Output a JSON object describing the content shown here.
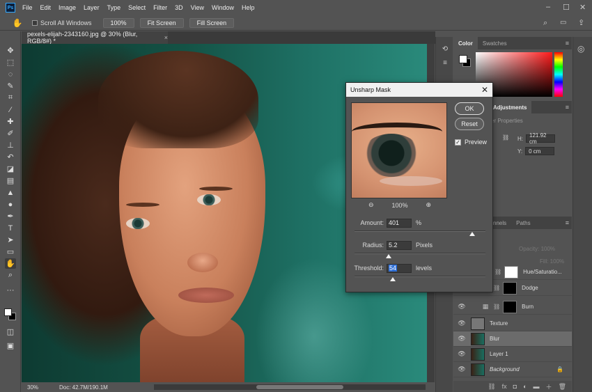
{
  "menubar": {
    "logo": "Ps",
    "items": [
      "File",
      "Edit",
      "Image",
      "Layer",
      "Type",
      "Select",
      "Filter",
      "3D",
      "View",
      "Window",
      "Help"
    ]
  },
  "options": {
    "scroll_all": "Scroll All Windows",
    "zoom_btn": "100%",
    "fit_btn": "Fit Screen",
    "fill_btn": "Fill Screen"
  },
  "document": {
    "tab_title": "pexels-elijah-2343160.jpg @ 30% (Blur, RGB/8#) *",
    "close": "×"
  },
  "status": {
    "zoom": "30%",
    "doc_size": "Doc: 42.7M/190.1M"
  },
  "color_panel": {
    "tabs": [
      "Color",
      "Swatches"
    ],
    "fg": "#ffffff",
    "bg": "#000000",
    "hue": "#ff1a1a"
  },
  "properties_panel": {
    "tab_fragment": "Adjustments",
    "title_fragment": "yer Properties",
    "h_label": "H:",
    "h_value": "121.92 cm",
    "y_label": "Y:",
    "y_value": "0 cm"
  },
  "layers_panel": {
    "tabs": [
      "nnels",
      "Paths"
    ],
    "opacity_label": "Opacity: 100%",
    "fill_label": "Fill: 100%",
    "layers": [
      {
        "name": "Hue/Saturatio...",
        "kind": "adjustment"
      },
      {
        "name": "Dodge",
        "kind": "adjustment"
      },
      {
        "name": "Burn",
        "kind": "adjustment"
      },
      {
        "name": "Texture",
        "kind": "gray"
      },
      {
        "name": "Blur",
        "kind": "photo",
        "selected": true
      },
      {
        "name": "Layer 1",
        "kind": "photo"
      },
      {
        "name": "Background",
        "kind": "photo",
        "locked": true
      }
    ]
  },
  "dialog": {
    "title": "Unsharp Mask",
    "ok": "OK",
    "reset": "Reset",
    "preview_label": "Preview",
    "preview_checked": true,
    "zoom_level": "100%",
    "amount": {
      "label": "Amount:",
      "value": "401",
      "unit": "%",
      "slider": 0.9
    },
    "radius": {
      "label": "Radius:",
      "value": "5.2",
      "unit": "Pixels",
      "slider": 0.26
    },
    "threshold": {
      "label": "Threshold:",
      "value": "54",
      "unit": "levels",
      "slider": 0.29
    }
  }
}
